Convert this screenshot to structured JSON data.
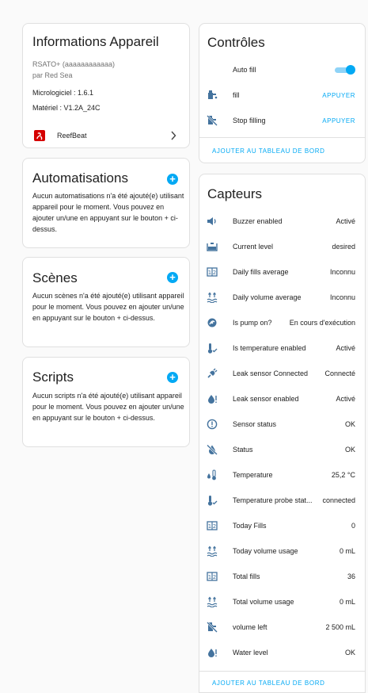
{
  "device": {
    "title": "Informations Appareil",
    "model": "RSATO+ (aaaaaaaaaaaa)",
    "manufacturer": "par Red Sea",
    "firmware": "Micrologiciel : 1.6.1",
    "hardware": "Matériel : V1.2A_24C",
    "integration": "ReefBeat"
  },
  "automations": {
    "title": "Automatisations",
    "text": "Aucun automatisations n'a été ajouté(e) utilisant appareil pour le moment. Vous pouvez en ajouter un/une en appuyant sur le bouton + ci-dessus."
  },
  "scenes": {
    "title": "Scènes",
    "text": "Aucun scènes n'a été ajouté(e) utilisant appareil pour le moment. Vous pouvez en ajouter un/une en appuyant sur le bouton + ci-dessus."
  },
  "scripts": {
    "title": "Scripts",
    "text": "Aucun scripts n'a été ajouté(e) utilisant appareil pour le moment. Vous pouvez en ajouter un/une en appuyant sur le bouton + ci-dessus."
  },
  "controls": {
    "title": "Contrôles",
    "items": [
      {
        "label": "Auto fill",
        "icon": "none",
        "type": "toggle",
        "on": true
      },
      {
        "label": "fill",
        "icon": "water-pump-icon",
        "type": "button",
        "action": "APPUYER"
      },
      {
        "label": "Stop filling",
        "icon": "water-pump-off-icon",
        "type": "button",
        "action": "APPUYER"
      }
    ],
    "footer": "AJOUTER AU TABLEAU DE BORD"
  },
  "sensors": {
    "title": "Capteurs",
    "items": [
      {
        "label": "Buzzer enabled",
        "value": "Activé",
        "icon": "volume-icon"
      },
      {
        "label": "Current level",
        "value": "desired",
        "icon": "tank-level-icon"
      },
      {
        "label": "Daily fills average",
        "value": "Inconnu",
        "icon": "counter-icon"
      },
      {
        "label": "Daily volume average",
        "value": "Inconnu",
        "icon": "waves-arrow-up-icon"
      },
      {
        "label": "Is pump on?",
        "value": "En cours d'exécution",
        "icon": "pump-icon"
      },
      {
        "label": "Is temperature enabled",
        "value": "Activé",
        "icon": "thermometer-check-icon"
      },
      {
        "label": "Leak sensor Connected",
        "value": "Connecté",
        "icon": "plug-connected-icon"
      },
      {
        "label": "Leak sensor enabled",
        "value": "Activé",
        "icon": "water-alert-icon"
      },
      {
        "label": "Sensor status",
        "value": "OK",
        "icon": "alert-circle-icon"
      },
      {
        "label": "Status",
        "value": "OK",
        "icon": "water-off-icon"
      },
      {
        "label": "Temperature",
        "value": "25,2 °C",
        "icon": "thermometer-water-icon"
      },
      {
        "label": "Temperature probe stat...",
        "value": "connected",
        "icon": "thermometer-check-icon"
      },
      {
        "label": "Today Fills",
        "value": "0",
        "icon": "counter-icon"
      },
      {
        "label": "Today volume usage",
        "value": "0 mL",
        "icon": "waves-arrow-up-icon"
      },
      {
        "label": "Total fills",
        "value": "36",
        "icon": "counter-icon"
      },
      {
        "label": "Total volume usage",
        "value": "0 mL",
        "icon": "waves-arrow-up-icon"
      },
      {
        "label": "volume left",
        "value": "2 500 mL",
        "icon": "water-pump-off-icon"
      },
      {
        "label": "Water level",
        "value": "OK",
        "icon": "water-alert-icon"
      }
    ],
    "footer": "AJOUTER AU TABLEAU DE BORD"
  },
  "colors": {
    "accent": "#03a9f4",
    "icon": "#44739e",
    "brand": "#d50000"
  }
}
